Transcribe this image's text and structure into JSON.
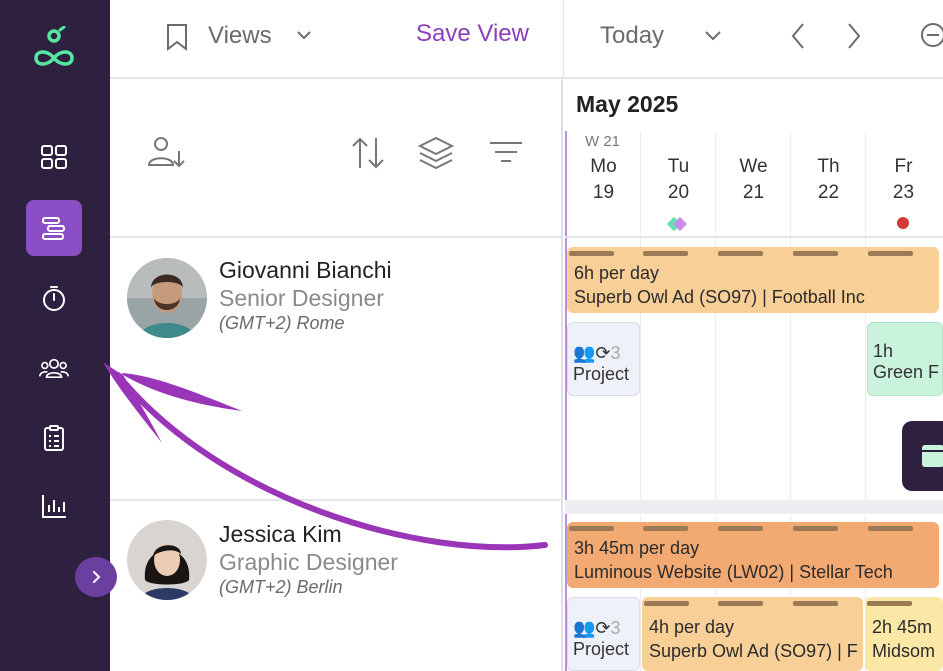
{
  "toolbar": {
    "views_label": "Views",
    "save_view_label": "Save View",
    "today_label": "Today"
  },
  "calendar": {
    "month": "May 2025",
    "week": "W 21",
    "days": [
      {
        "name": "Mo",
        "num": "19"
      },
      {
        "name": "Tu",
        "num": "20"
      },
      {
        "name": "We",
        "num": "21"
      },
      {
        "name": "Th",
        "num": "22"
      },
      {
        "name": "Fr",
        "num": "23"
      }
    ]
  },
  "people": [
    {
      "name": "Giovanni Bianchi",
      "role": "Senior Designer",
      "location": "(GMT+2) Rome"
    },
    {
      "name": "Jessica Kim",
      "role": "Graphic Designer",
      "location": "(GMT+2) Berlin"
    }
  ],
  "assignments": {
    "g_bar": {
      "line1": "6h per day",
      "line2": "Superb Owl Ad (SO97) | Football Inc"
    },
    "g_card1": {
      "icons": "3",
      "label": "Project"
    },
    "g_card2": {
      "line1": "1h",
      "line2": "Green F"
    },
    "j_bar": {
      "line1": "3h 45m per day",
      "line2": "Luminous Website (LW02) | Stellar Tech"
    },
    "j_card1": {
      "icons": "3",
      "label": "Project"
    },
    "j_bar2": {
      "line1": "4h per day",
      "line2": "Superb Owl Ad (SO97) | F"
    },
    "j_bar3": {
      "line1": "2h 45m",
      "line2": "Midsom"
    }
  },
  "colors": {
    "sidebar": "#2e2140",
    "accent": "#8a4fc5",
    "save_view": "#8a3fbd",
    "bar_orange": "#f8cf96",
    "bar_darkorange": "#f2aa72",
    "bar_green": "#c9f3dc",
    "bar_yellow": "#fbe7a6",
    "arrow": "#9a35b8"
  }
}
